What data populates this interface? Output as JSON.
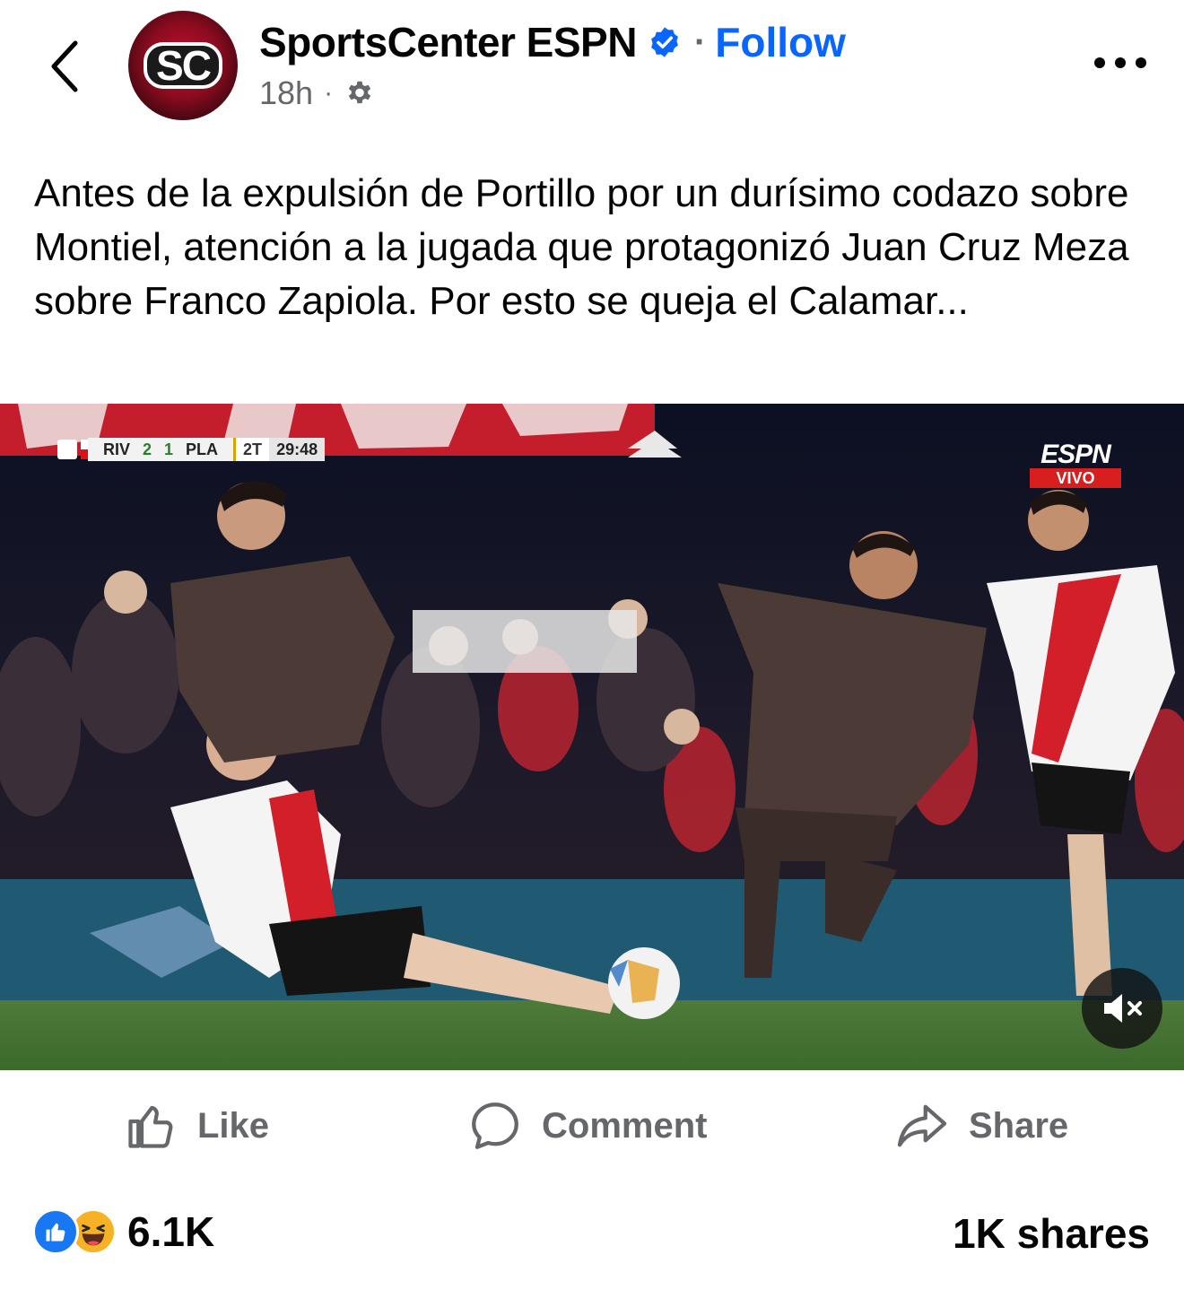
{
  "header": {
    "page_name": "SportsCenter ESPN",
    "avatar_text": "SC",
    "follow_label": "Follow",
    "separator": "·",
    "time": "18h",
    "time_separator": "·",
    "icons": {
      "back": "chevron-left-icon",
      "verified": "verified-badge-icon",
      "audience": "gear-icon",
      "more": "more-dots-icon"
    }
  },
  "post": {
    "text": "Antes de la expulsión de Portillo por un durísimo codazo sobre Montiel, atención a la jugada que protagonizó Juan Cruz Meza sobre Franco Zapiola. Por esto se queja el Calamar..."
  },
  "video": {
    "scorebug": {
      "home": "RIV",
      "home_score": "2",
      "away_score": "1",
      "away": "PLA",
      "period": "2T",
      "clock": "29:48"
    },
    "broadcaster": "ESPN",
    "live_label": "VIVO",
    "mute_state": "muted",
    "icons": {
      "mute": "speaker-muted-icon"
    }
  },
  "actions": {
    "like_label": "Like",
    "comment_label": "Comment",
    "share_label": "Share"
  },
  "footer": {
    "reaction_count": "6.1K",
    "reactions": [
      "like",
      "haha"
    ],
    "shares": "1K shares"
  },
  "colors": {
    "accent": "#0866ff",
    "secondary_text": "#65676b",
    "primary_text": "#050505",
    "like_reaction": "#1877f2",
    "haha_reaction": "#f7b125"
  }
}
